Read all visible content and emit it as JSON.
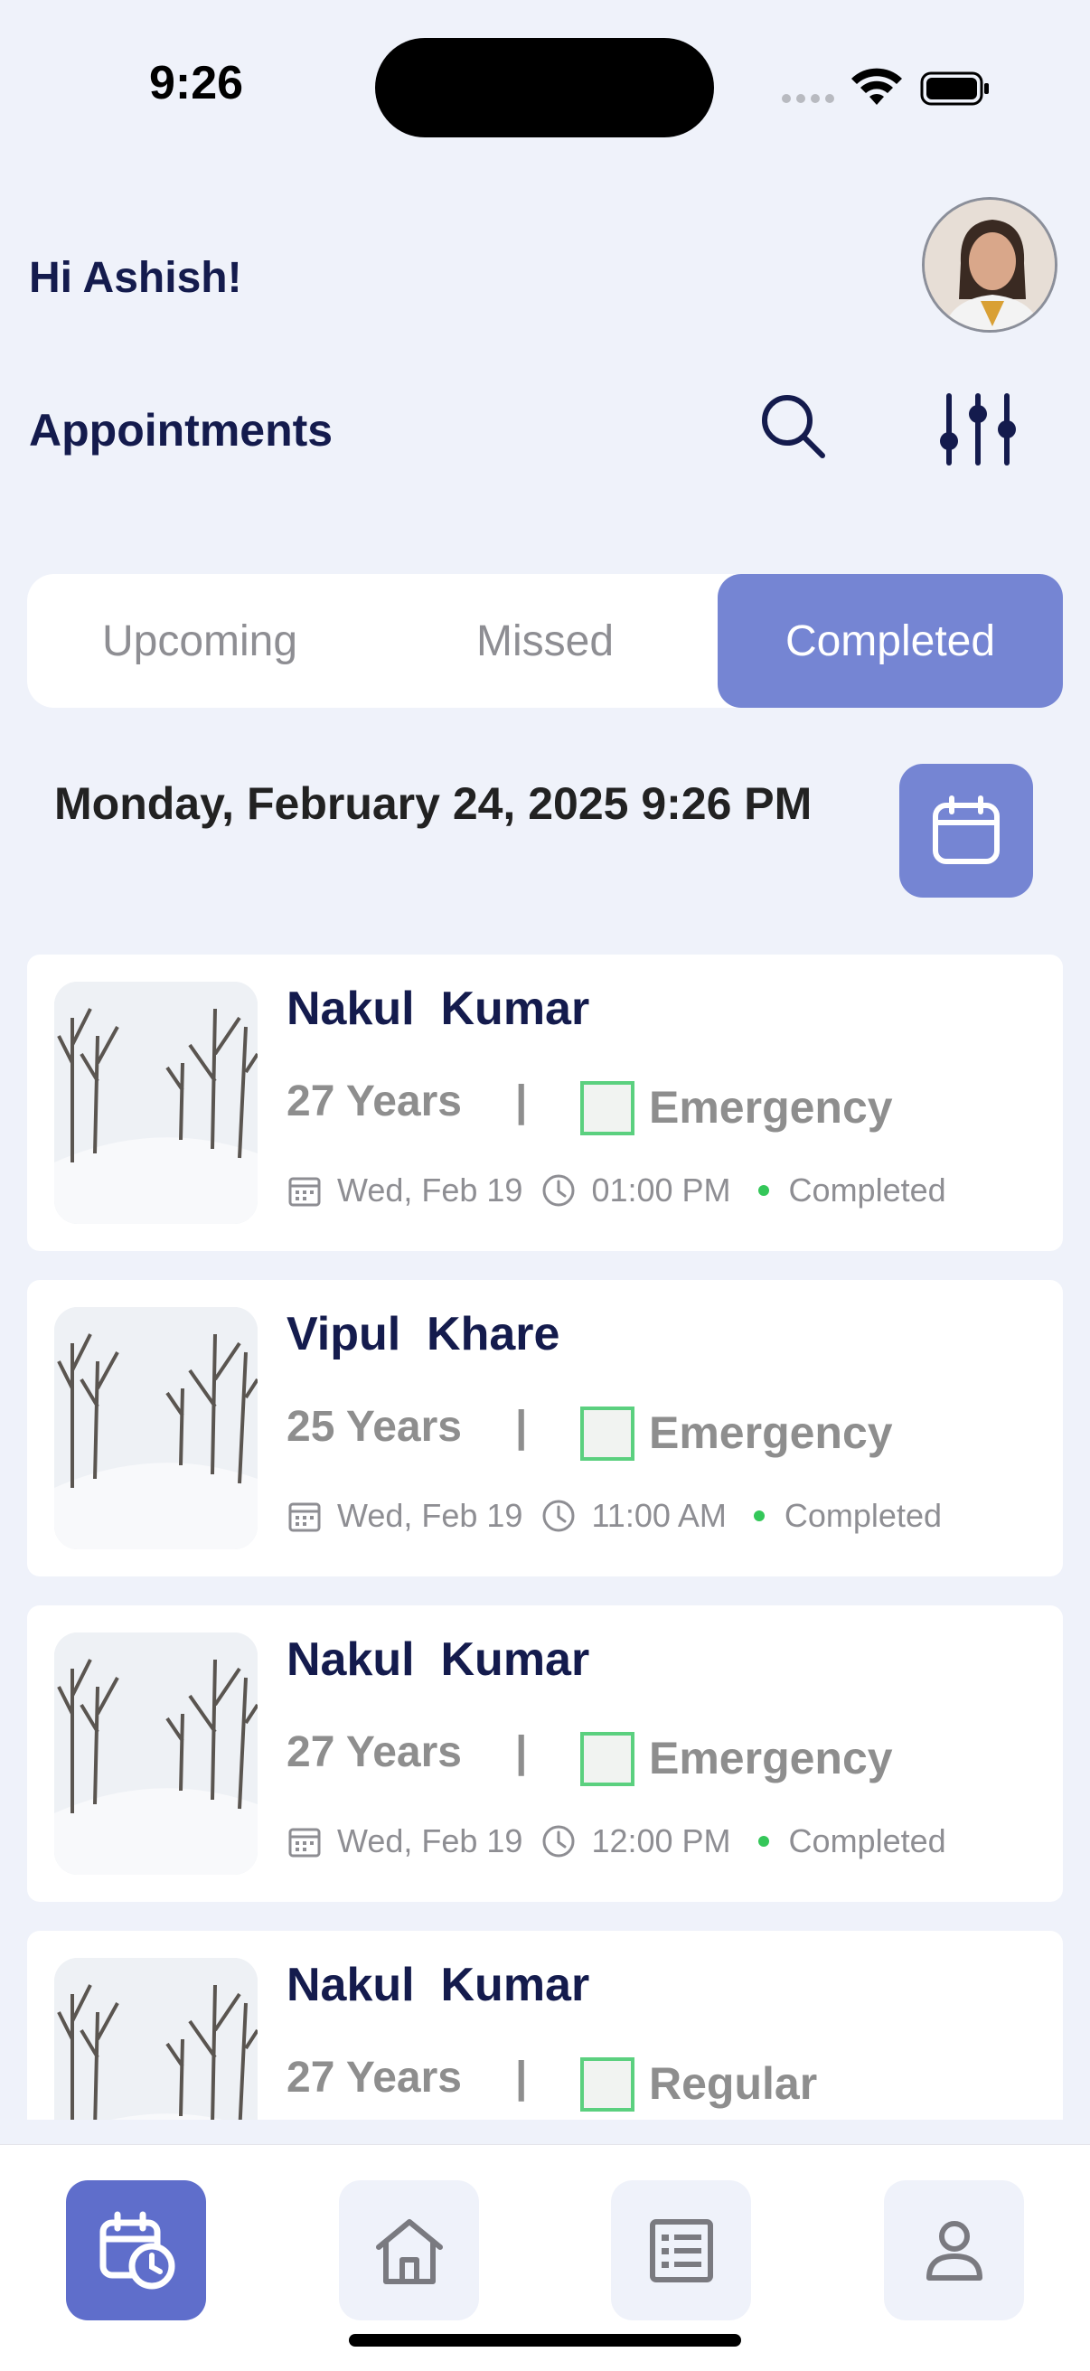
{
  "status_bar": {
    "time": "9:26"
  },
  "header": {
    "greeting": "Hi Ashish!",
    "section_title": "Appointments"
  },
  "tabs": [
    {
      "label": "Upcoming",
      "active": false
    },
    {
      "label": "Missed",
      "active": false
    },
    {
      "label": "Completed",
      "active": true
    }
  ],
  "date_heading": "Monday, February 24, 2025 9:26 PM",
  "appointments": [
    {
      "name": "Nakul  Kumar",
      "age": "27 Years",
      "type": "Emergency",
      "date": "Wed, Feb 19",
      "time": "01:00 PM",
      "status": "Completed"
    },
    {
      "name": "Vipul  Khare",
      "age": "25 Years",
      "type": "Emergency",
      "date": "Wed, Feb 19",
      "time": "11:00 AM",
      "status": "Completed"
    },
    {
      "name": "Nakul  Kumar",
      "age": "27 Years",
      "type": "Emergency",
      "date": "Wed, Feb 19",
      "time": "12:00 PM",
      "status": "Completed"
    },
    {
      "name": "Nakul  Kumar",
      "age": "27 Years",
      "type": "Regular",
      "date": "",
      "time": "",
      "status": ""
    }
  ],
  "separator": "|",
  "colors": {
    "accent": "#7585D3",
    "nav_active": "#5F6ECB",
    "navy": "#141B4D",
    "status_green": "#34C759",
    "background": "#EFF2FA"
  },
  "bottom_nav": [
    {
      "icon": "calendar-clock-icon",
      "active": true
    },
    {
      "icon": "home-icon",
      "active": false
    },
    {
      "icon": "list-icon",
      "active": false
    },
    {
      "icon": "person-icon",
      "active": false
    }
  ]
}
